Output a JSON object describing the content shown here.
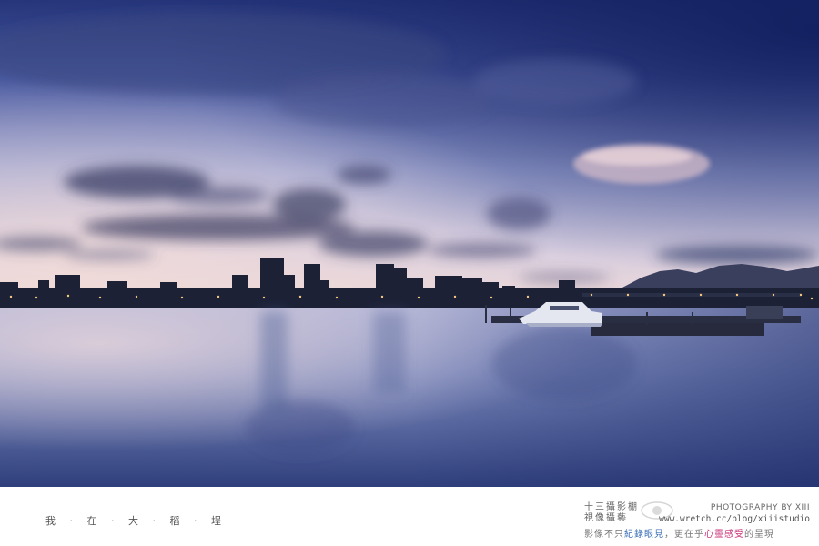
{
  "image": {
    "description_colors": {
      "sky_top": "#2a3f86",
      "sky_mid": "#8e97c8",
      "sky_horizon": "#e9d4d8",
      "water": "#6f7fb4",
      "city_silhouette": "#1a1f33"
    }
  },
  "footer": {
    "caption_left": "我 · 在 · 大 · 稻 · 埕",
    "studio_line1": "十三攝影棚",
    "studio_line2": "視像攝藝",
    "credit": "PHOTOGRAPHY BY XIII",
    "url": "www.wretch.cc/blog/xiiistudio",
    "motto_part1": "影像不只",
    "motto_hl1": "紀錄眼見",
    "motto_part2": "，更在乎",
    "motto_hl2": "心靈感受",
    "motto_part3": "的呈現",
    "motto_hl_blue": "#3a6fb6",
    "motto_hl_pink": "#c8347a"
  }
}
